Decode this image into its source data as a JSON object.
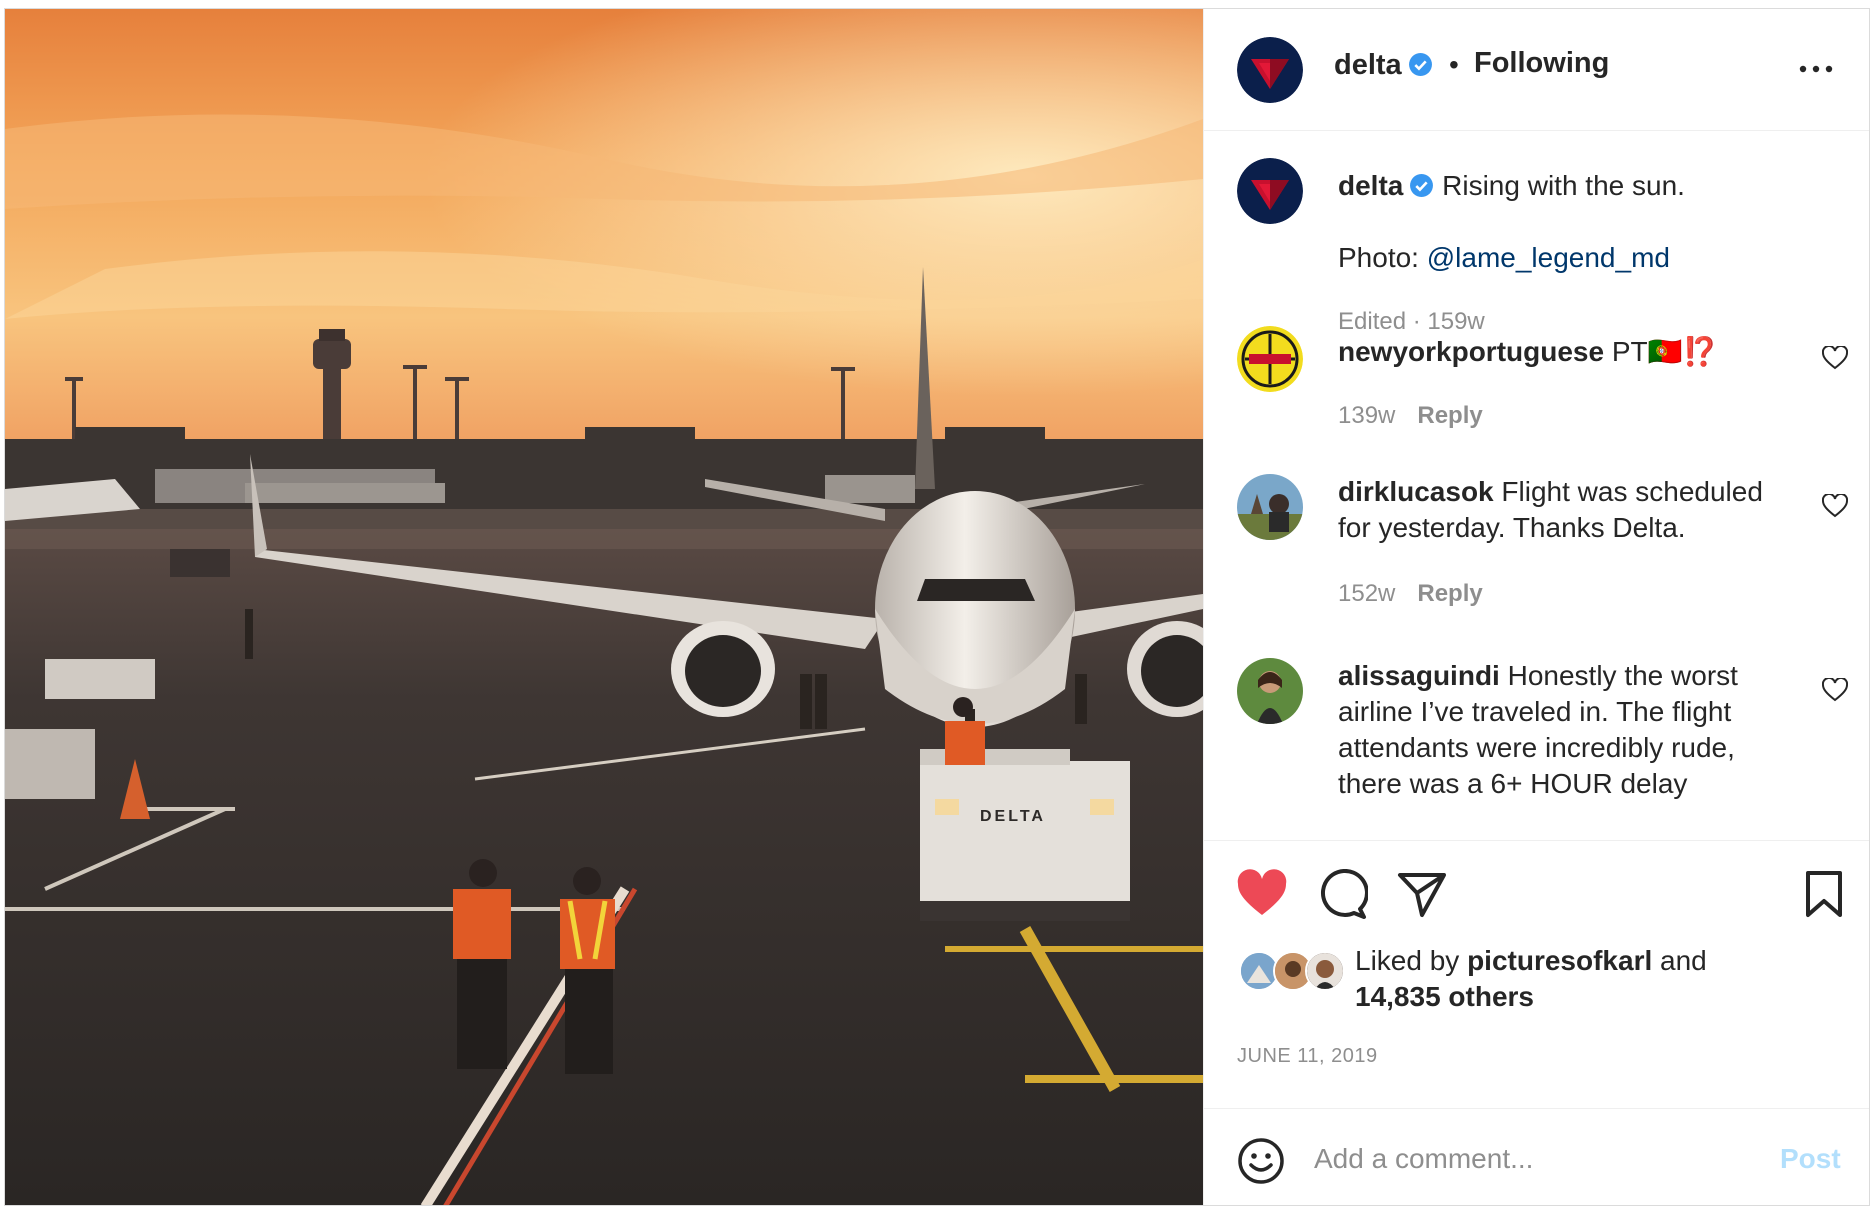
{
  "header": {
    "username": "delta",
    "separator": "•",
    "follow_status": "Following",
    "more_icon": "more-horizontal-icon"
  },
  "photo": {
    "truck_text": "DELTA"
  },
  "caption": {
    "username": "delta",
    "text": "Rising with the sun.",
    "credit_prefix": "Photo: ",
    "credit_handle": "@lame_legend_md",
    "meta": "Edited · 159w"
  },
  "comments": [
    {
      "username": "newyorkportuguese",
      "text": "PT",
      "emoji": "🇵🇹⁉️",
      "age": "139w",
      "reply_label": "Reply"
    },
    {
      "username": "dirklucasok",
      "text": "Flight was scheduled for yesterday. Thanks Delta.",
      "age": "152w",
      "reply_label": "Reply"
    },
    {
      "username": "alissaguindi",
      "text": "Honestly the worst airline I’ve traveled in. The flight attendants were incredibly rude, there was a 6+ HOUR delay"
    }
  ],
  "actions": {
    "like_icon": "heart-filled-icon",
    "comment_icon": "comment-icon",
    "share_icon": "send-icon",
    "save_icon": "bookmark-icon",
    "liked_by_prefix": "Liked by",
    "liked_by_user": "picturesofkarl",
    "liked_by_and": "and",
    "liked_by_others": "14,835 others",
    "date": "JUNE 11, 2019"
  },
  "add_comment": {
    "placeholder": "Add a comment...",
    "post_label": "Post"
  },
  "colors": {
    "like_red": "#ed4956",
    "link_blue": "#00376b",
    "verified_blue": "#3897f0",
    "post_disabled": "#b2dffc",
    "meta_gray": "#8e8e8e"
  }
}
